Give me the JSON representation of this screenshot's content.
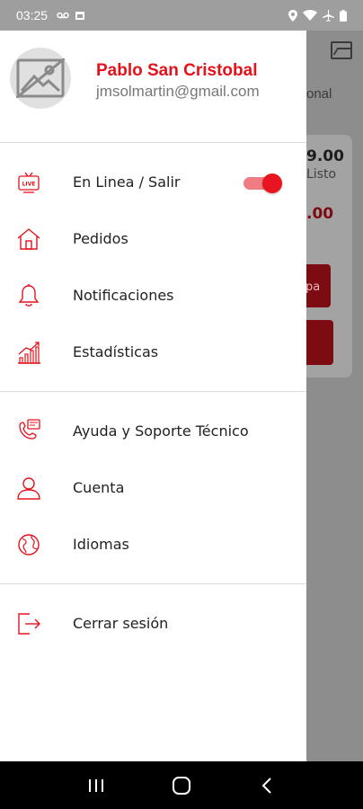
{
  "status_bar": {
    "time": "03:25",
    "left_icons": [
      "voicemail-icon",
      "calendar-icon"
    ],
    "right_icons": [
      "location-icon",
      "wifi-icon",
      "airplane-icon",
      "battery-icon"
    ]
  },
  "background": {
    "tab_partial": "onal",
    "amount": "9.00",
    "status_partial": "Listo",
    "amount2": ".00",
    "button_partial": "pa"
  },
  "drawer": {
    "profile": {
      "name": "Pablo San Cristobal",
      "email": "jmsolmartin@gmail.com",
      "avatar_icon": "image-placeholder-icon"
    },
    "group1": [
      {
        "label": "En Linea / Salir",
        "icon": "live-tv-icon",
        "toggle_on": true
      },
      {
        "label": "Pedidos",
        "icon": "home-icon"
      },
      {
        "label": "Notificaciones",
        "icon": "bell-icon"
      },
      {
        "label": "Estadísticas",
        "icon": "stats-icon"
      }
    ],
    "group2": [
      {
        "label": "Ayuda y Soporte Técnico",
        "icon": "support-phone-icon"
      },
      {
        "label": "Cuenta",
        "icon": "user-icon"
      },
      {
        "label": "Idiomas",
        "icon": "globe-icon"
      }
    ],
    "group3": [
      {
        "label": "Cerrar sesión",
        "icon": "logout-icon"
      }
    ]
  },
  "colors": {
    "accent": "#e5121c",
    "toggle_track": "#f07b82",
    "nav_bar": "#000000"
  },
  "nav_bar": {
    "buttons": [
      "recents-button",
      "home-button",
      "back-button"
    ]
  }
}
